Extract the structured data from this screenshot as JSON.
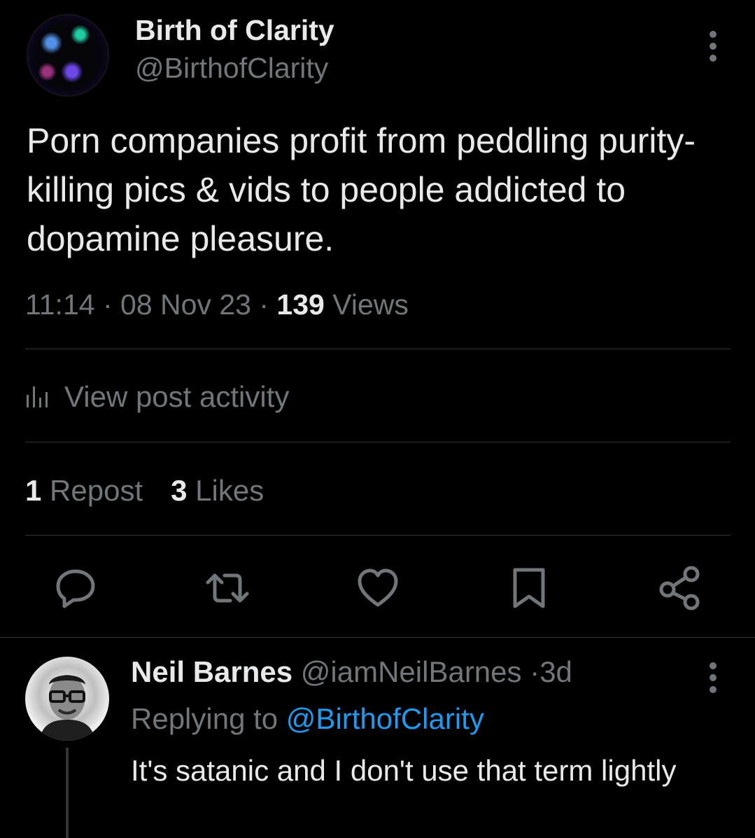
{
  "post": {
    "author_name": "Birth of Clarity",
    "author_handle": "@BirthofClarity",
    "text": "Porn companies profit from peddling purity-killing pics & vids to people addicted to dopamine pleasure.",
    "time": "11:14",
    "date": "08 Nov 23",
    "separator": "·",
    "views_count": "139",
    "views_label": "Views",
    "activity_label": "View post activity",
    "reposts_count": "1",
    "reposts_label": "Repost",
    "likes_count": "3",
    "likes_label": "Likes"
  },
  "actions": [
    "reply-icon",
    "repost-icon",
    "like-icon",
    "bookmark-icon",
    "share-icon"
  ],
  "reply": {
    "author_name": "Neil Barnes",
    "author_handle": "@iamNeilBarnes",
    "age": "3d",
    "replying_prefix": "Replying to",
    "replying_handle": "@BirthofClarity",
    "text": "It's satanic and I don't use that term lightly"
  },
  "colors": {
    "background": "#000000",
    "text": "#e7e9ea",
    "muted": "#71767b",
    "accent": "#1d9bf0",
    "divider": "#2f3336"
  }
}
